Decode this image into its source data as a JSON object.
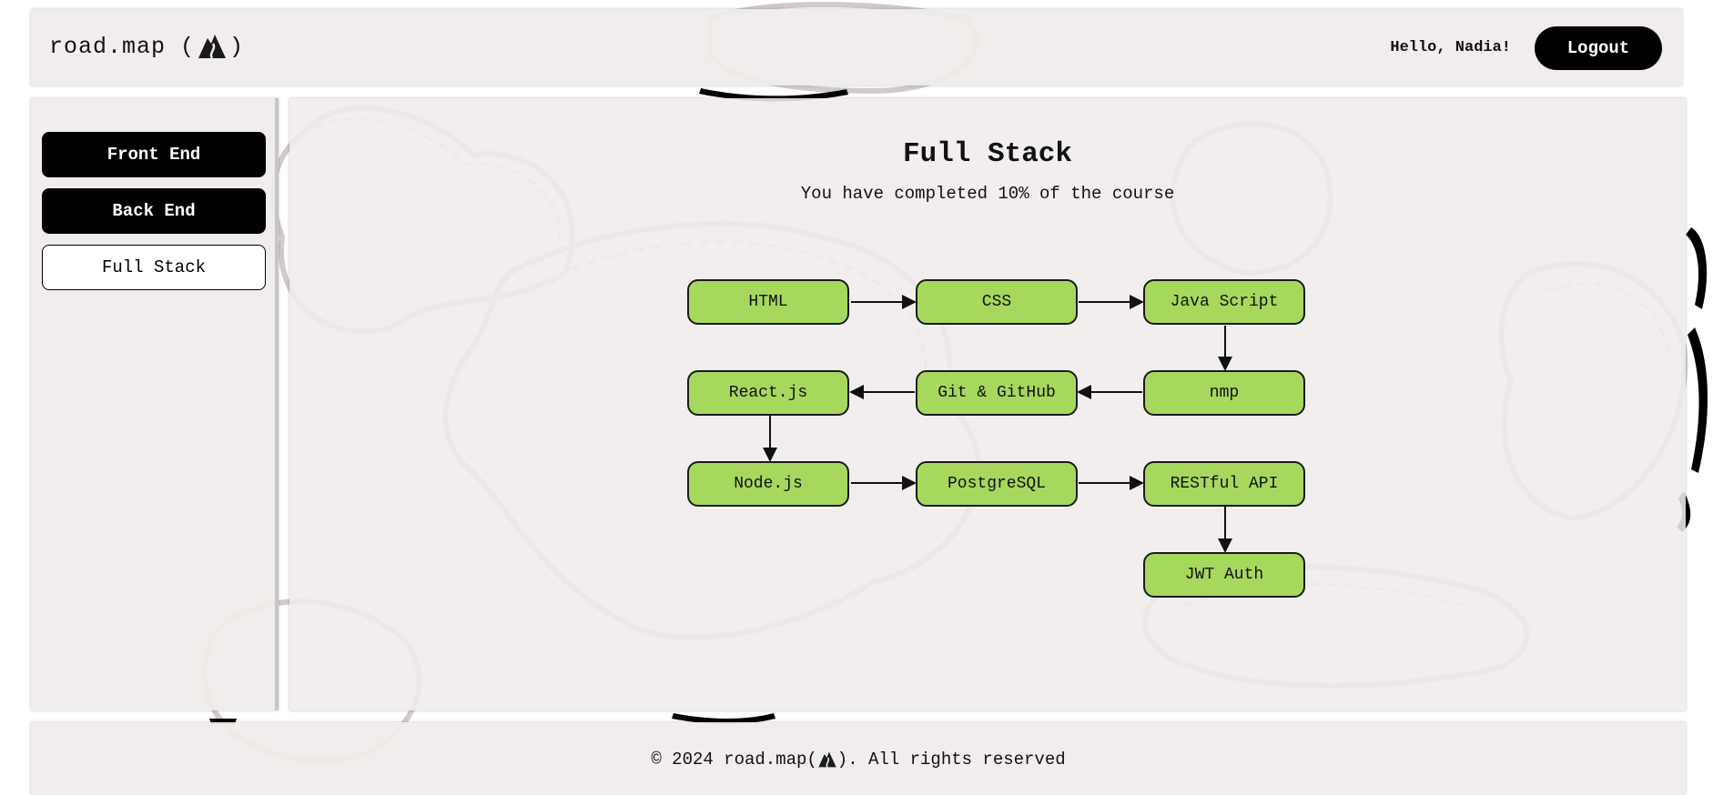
{
  "header": {
    "brand_text": "road.map (",
    "brand_close": ")",
    "greeting": "Hello, Nadia!",
    "logout_label": "Logout"
  },
  "sidebar": {
    "items": [
      {
        "label": "Front End",
        "active": false
      },
      {
        "label": "Back End",
        "active": false
      },
      {
        "label": "Full Stack",
        "active": true
      }
    ]
  },
  "main": {
    "title": "Full Stack",
    "progress_text": "You have completed 10% of the course",
    "progress_percent": 10,
    "nodes": [
      "HTML",
      "CSS",
      "Java Script",
      "nmp",
      "Git & GitHub",
      "React.js",
      "Node.js",
      "PostgreSQL",
      "RESTful API",
      "JWT Auth"
    ],
    "node_color": "#a6d85e"
  },
  "footer": {
    "prefix": "© 2024 road.map(",
    "suffix": "). All rights reserved"
  }
}
